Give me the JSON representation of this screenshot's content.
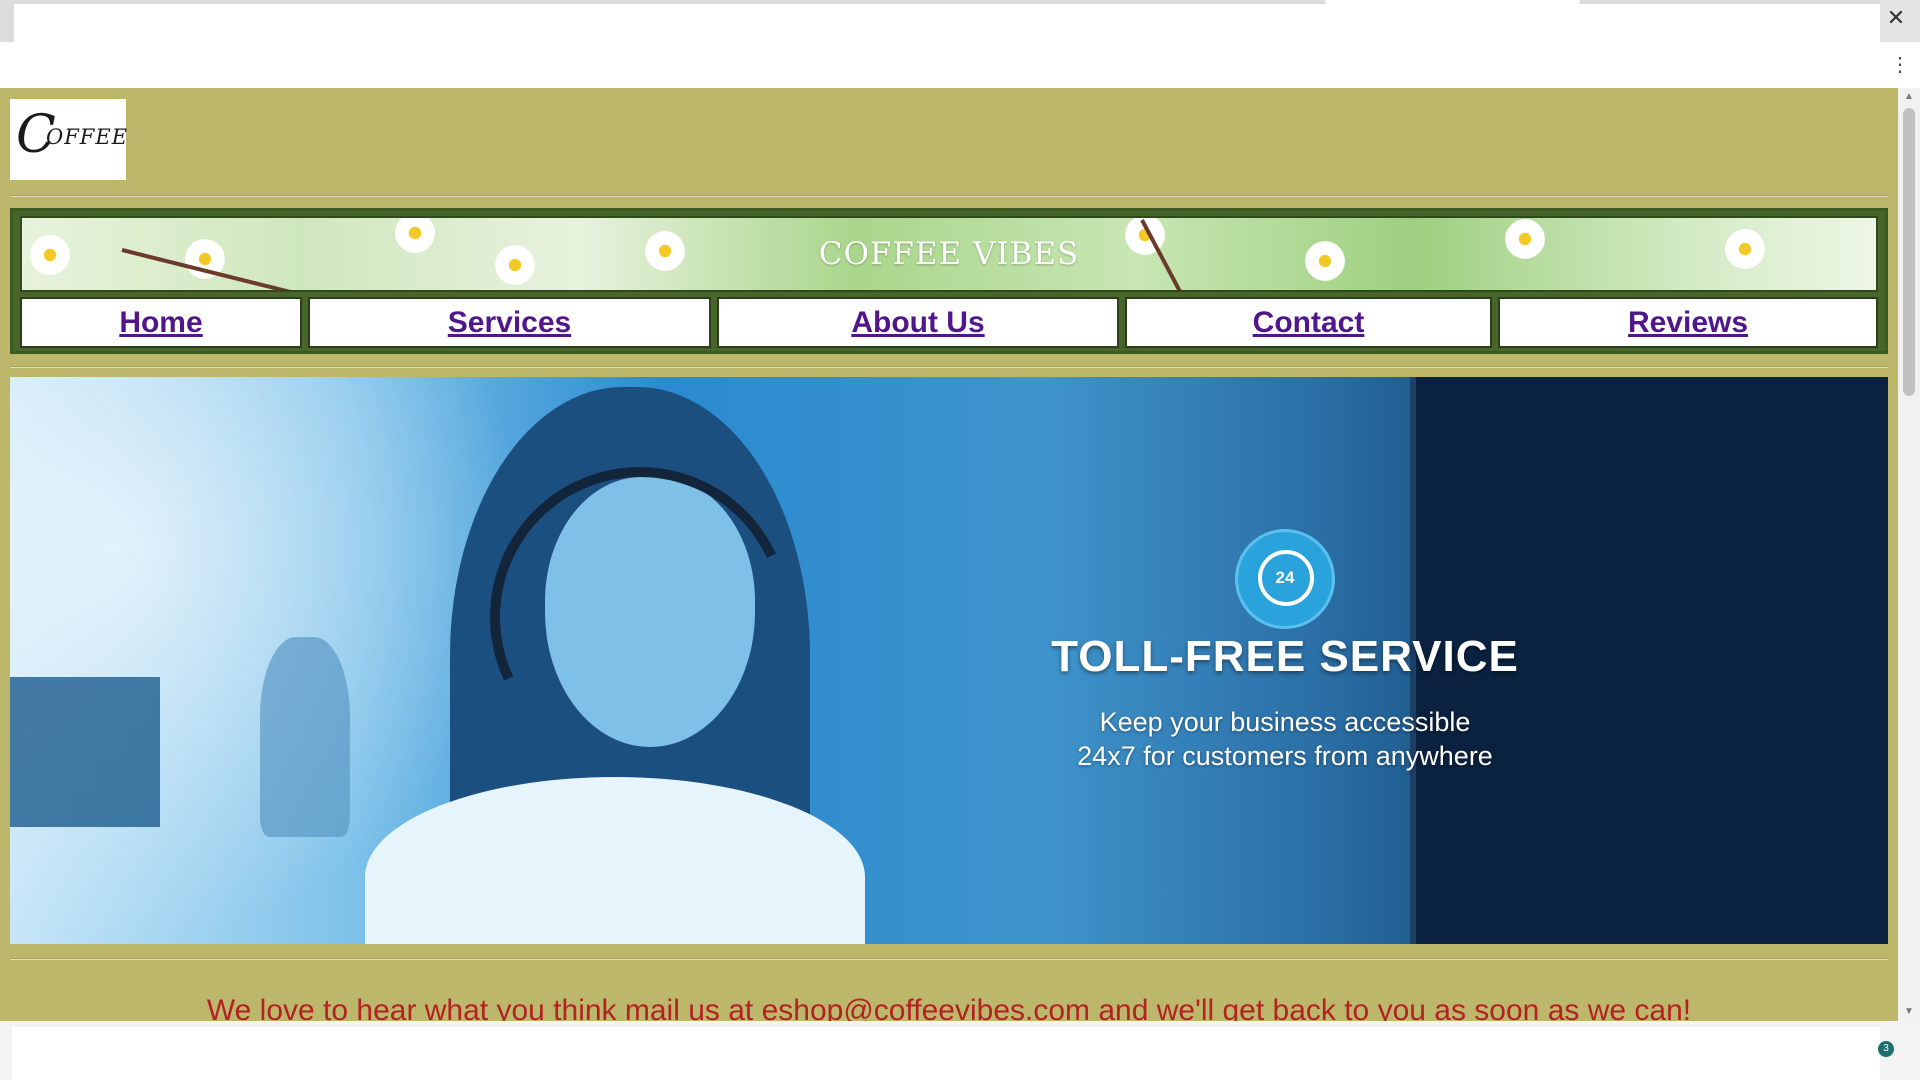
{
  "browser": {
    "close_glyph": "✕",
    "menu_glyph": "⋮",
    "notification_count": "3"
  },
  "logo": {
    "first_letter": "C",
    "rest": "OFFEE"
  },
  "banner": {
    "title": "COFFEE VIBES"
  },
  "nav": {
    "items": [
      {
        "label": "Home"
      },
      {
        "label": "Services"
      },
      {
        "label": "About Us"
      },
      {
        "label": "Contact"
      },
      {
        "label": "Reviews"
      }
    ]
  },
  "hero": {
    "badge_number": "24",
    "title": "TOLL-FREE SERVICE",
    "subtitle_line1": "Keep your business accessible",
    "subtitle_line2": "24x7 for customers from anywhere"
  },
  "footer_message": "We love to hear what you think mail us at eshop@coffeevibes.com and we'll get back to you as soon as we can!",
  "colors": {
    "page_background": "#bdb76b",
    "nav_link": "#52168c",
    "message_text": "#b22222"
  }
}
